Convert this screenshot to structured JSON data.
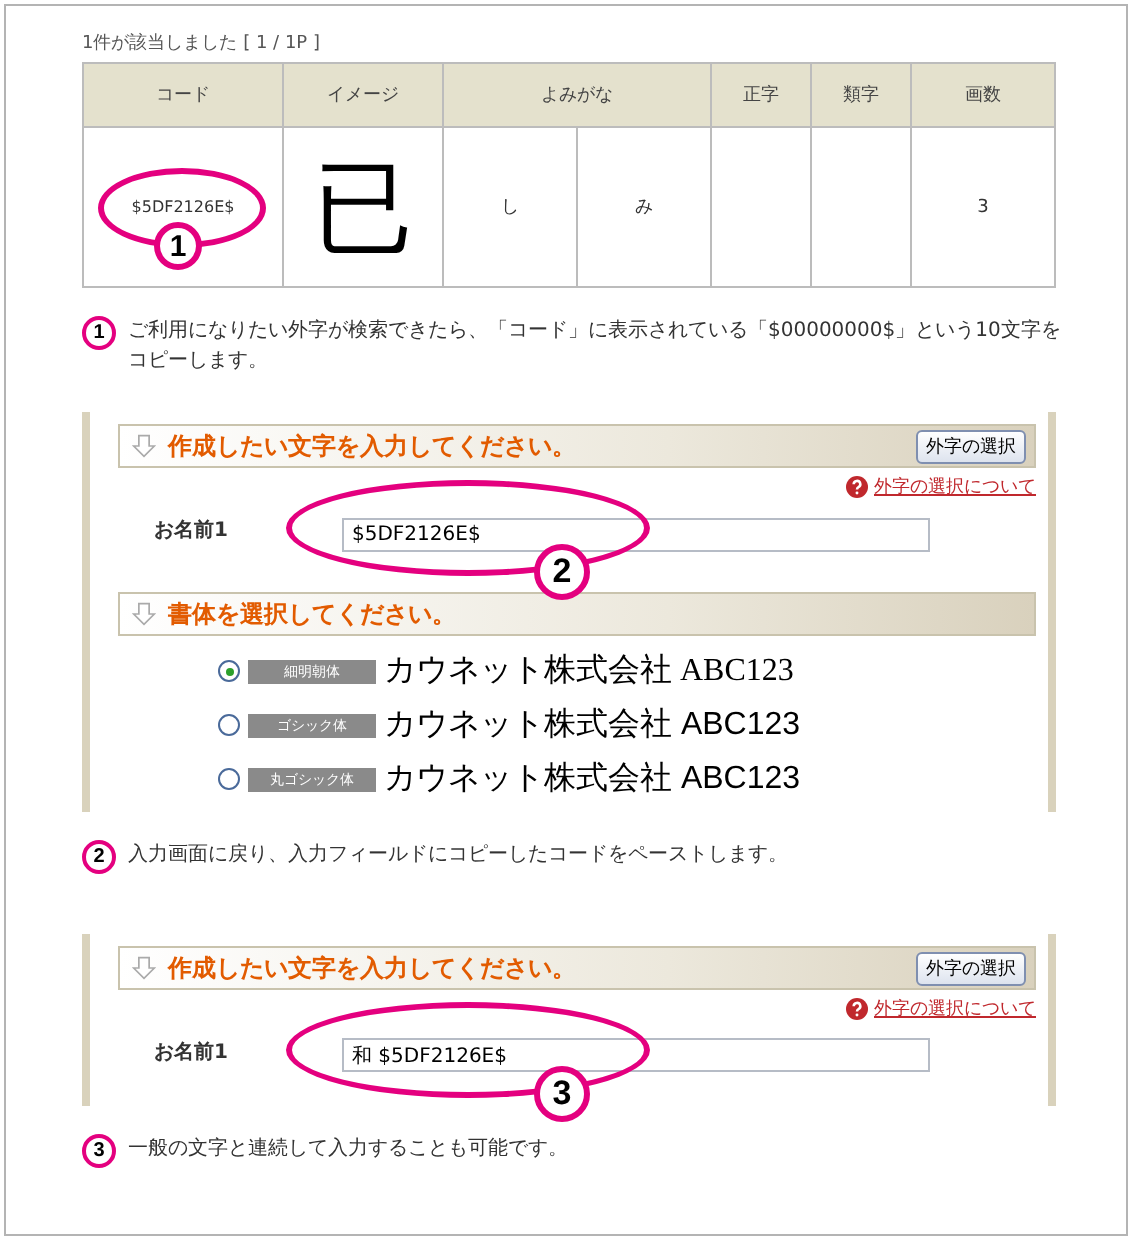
{
  "result_count": "1件が該当しました [ 1 / 1P ]",
  "table": {
    "columns": [
      "コード",
      "イメージ",
      "よみがな",
      "正字",
      "類字",
      "画数"
    ],
    "rows": [
      {
        "code": "$5DF2126E$",
        "image": "已",
        "yomigana": [
          "し",
          "み"
        ],
        "stroke_count": "3",
        "callout": "1"
      }
    ]
  },
  "steps": [
    {
      "number": "1",
      "text": "ご利用になりたい外字が検索できたら、「コード」に表示されている「$00000000$」という10文字をコピーします。"
    },
    {
      "number": "2",
      "text": "入力画面に戻り、入力フィールドにコピーしたコードをペーストします。"
    },
    {
      "number": "3",
      "text": "一般の文字と連続して入力することも可能です。"
    }
  ],
  "forms": [
    {
      "section_title": "作成したい文字を入力してください。",
      "gaiji_button": "外字の選択",
      "help_link": "外字の選択について",
      "field_label": "お名前1",
      "field_value": "$5DF2126E$",
      "callout": "2",
      "font_section_title": "書体を選択してください。",
      "font_options": [
        {
          "badge": "細明朝体",
          "sample": "カウネット株式会社 ABC123",
          "kind": "serif",
          "selected": true
        },
        {
          "badge": "ゴシック体",
          "sample": "カウネット株式会社 ABC123",
          "kind": "sans",
          "selected": false
        },
        {
          "badge": "丸ゴシック体",
          "sample": "カウネット株式会社 ABC123",
          "kind": "sans",
          "selected": false
        }
      ]
    },
    {
      "section_title": "作成したい文字を入力してください。",
      "gaiji_button": "外字の選択",
      "help_link": "外字の選択について",
      "field_label": "お名前1",
      "field_value": "和 $5DF2126E$",
      "callout": "3"
    }
  ]
}
